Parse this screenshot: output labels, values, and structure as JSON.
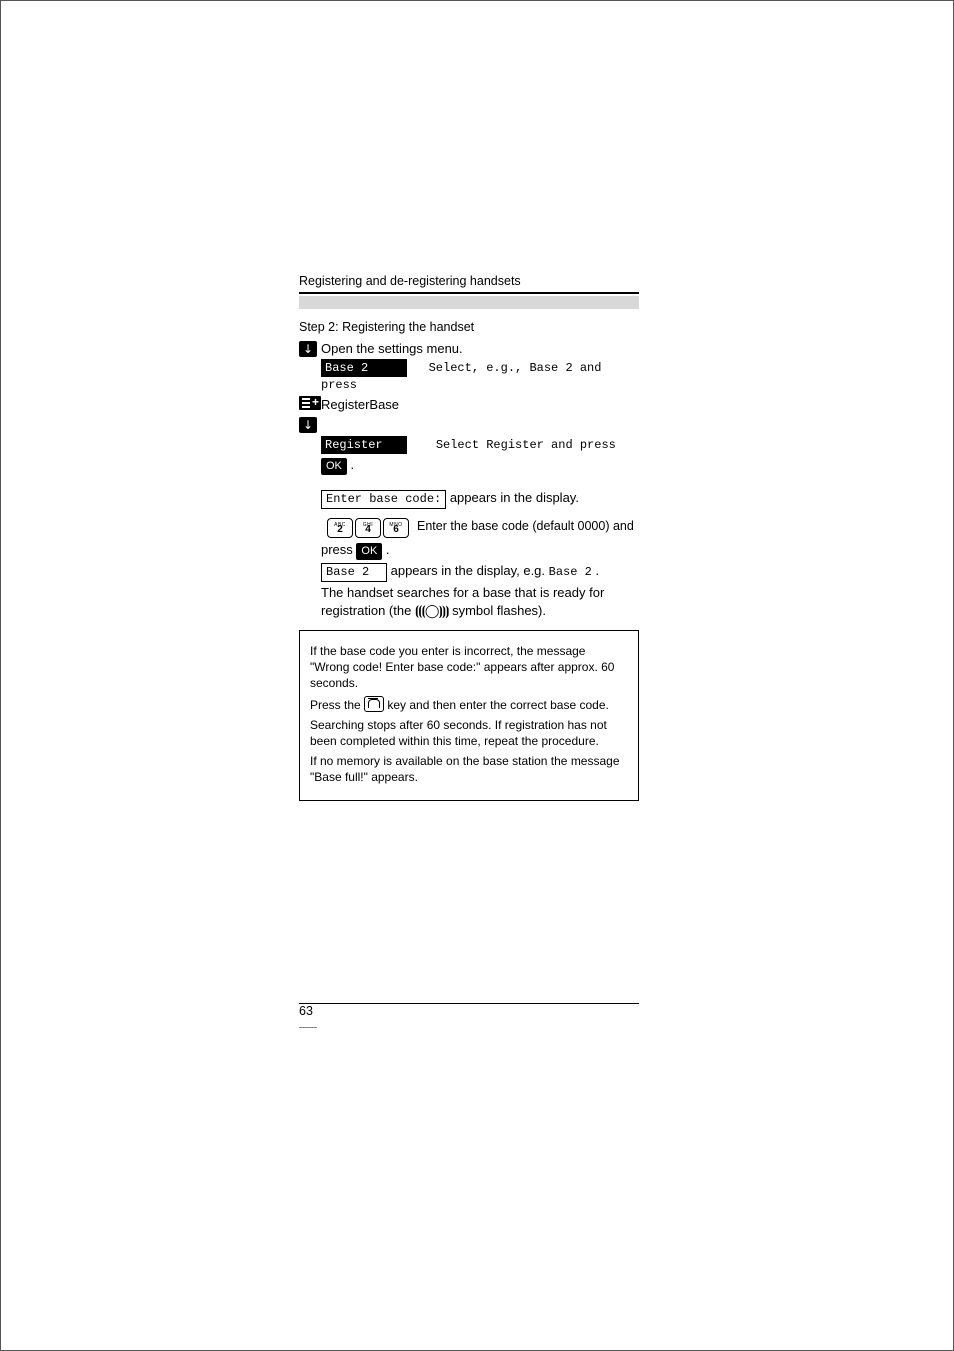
{
  "heading": {
    "section": "Registering and de-registering handsets",
    "step_title": "Step 2: Registering the handset"
  },
  "lines": {
    "l01": "Open the settings menu.",
    "l02_pre": "Select, e.g., ",
    "l02_code": "Base 2",
    "l02_post": " and press",
    "registerbase": "RegisterBase",
    "l03_pre": "Select ",
    "l03_code": "Register",
    "l03_post": " and press",
    "ok": "OK",
    "prompt_box": "Enter base code:",
    "prompt_tail": " appears in the display.",
    "enter_code": "Enter the base code (default 0000) and",
    "press": "press ",
    "after1_a": " appears in the display, e.g. ",
    "after1_code": "Base 2",
    "after2": "The handset searches for a base that is ready for",
    "after3_pre": "registration (the ",
    "after3_post": " symbol flashes)."
  },
  "keys": {
    "k1_sup": "ABC",
    "k1_main": "2",
    "k2_sup": "GHI",
    "k2_main": "4",
    "k3_sup": "MNO",
    "k3_main": "6"
  },
  "infobox": {
    "p1": "If the base code you enter is incorrect, the message \"Wrong code! Enter base code:\" appears after approx. 60 seconds.",
    "p2_a": "Press the ",
    "p2_b": " key and then enter the correct base code.",
    "p3": "Searching stops after 60 seconds. If registration has not been completed within this time, repeat the procedure.",
    "p4": "If no memory is available on the base station the message \"Base full!\" appears."
  },
  "pills": {
    "base2": "Base 2",
    "register": "Register"
  },
  "page_number": "63"
}
